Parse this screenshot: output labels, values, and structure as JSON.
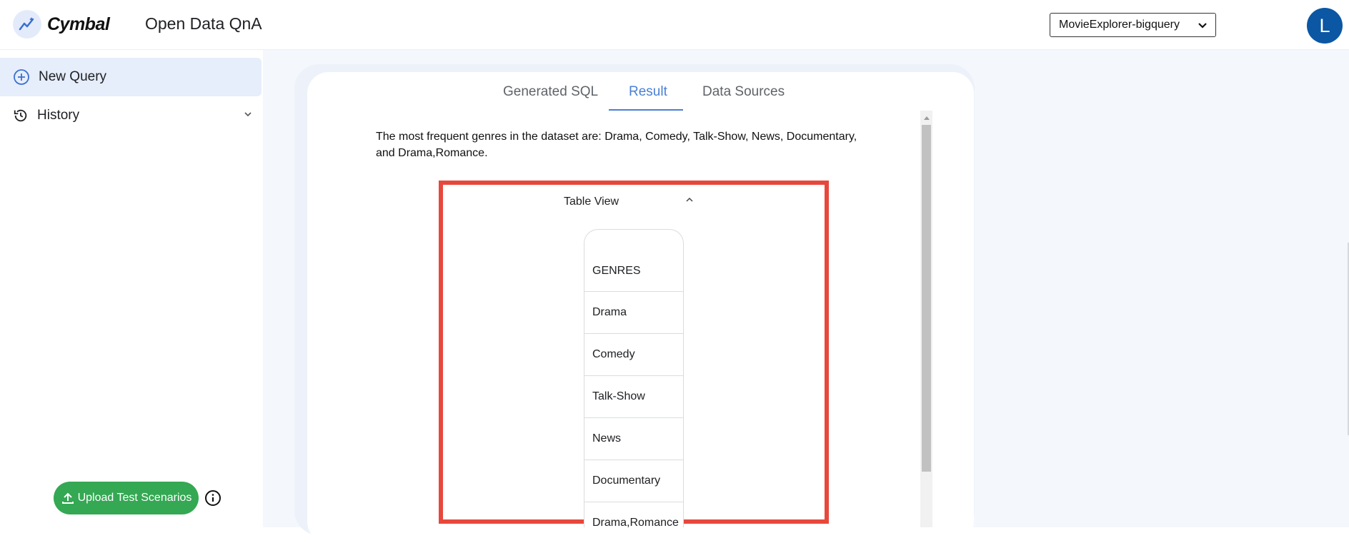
{
  "header": {
    "brand": "Cymbal",
    "app_title": "Open Data QnA",
    "dataset_select": {
      "value": "MovieExplorer-bigquery"
    },
    "avatar_initial": "L"
  },
  "sidebar": {
    "items": [
      {
        "label": "New Query",
        "icon": "plus-circle-icon",
        "active": true
      },
      {
        "label": "History",
        "icon": "history-icon",
        "expandable": true
      }
    ],
    "upload_button": "Upload Test Scenarios",
    "info_icon": "info-icon"
  },
  "main": {
    "tabs": [
      {
        "label": "Generated SQL",
        "active": false
      },
      {
        "label": "Result",
        "active": true
      },
      {
        "label": "Data Sources",
        "active": false
      }
    ],
    "summary": "The most frequent genres in the dataset are: Drama, Comedy, Talk-Show, News, Documentary, and Drama,Romance.",
    "table_view": {
      "label": "Table View",
      "column": "GENRES",
      "rows": [
        "Drama",
        "Comedy",
        "Talk-Show",
        "News",
        "Documentary",
        "Drama,Romance"
      ]
    }
  },
  "colors": {
    "accent": "#4a7fd6",
    "upload_button": "#34a853",
    "highlight": "#e8473c",
    "avatar": "#0b57a4"
  }
}
